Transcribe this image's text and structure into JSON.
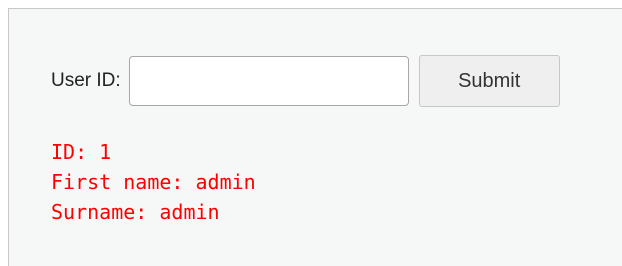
{
  "form": {
    "user_id_label": "User ID:",
    "user_id_value": "",
    "submit_label": "Submit"
  },
  "result": {
    "lines": [
      "ID: 1",
      "First name: admin",
      "Surname: admin"
    ]
  },
  "colors": {
    "result_text": "#ff0000",
    "panel_background": "#f6f7f7"
  }
}
